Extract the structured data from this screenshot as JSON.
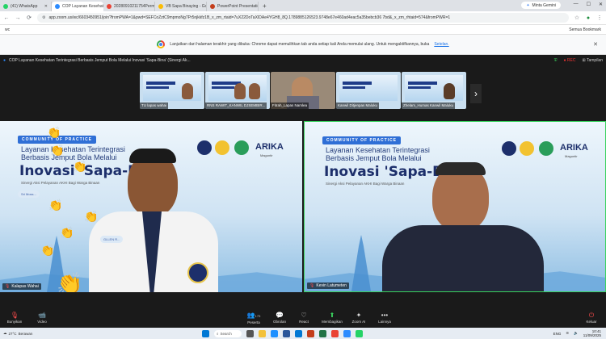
{
  "browser": {
    "tabs": [
      {
        "label": "(41) WhatsApp",
        "color": "#25d366",
        "active": false
      },
      {
        "label": "COP Layanan Kesehatan Te...",
        "color": "#2d8cff",
        "active": true
      },
      {
        "label": "20280910211754Permohonan...",
        "color": "#ea4335",
        "active": false
      },
      {
        "label": "VB Sapa Binaying - Google Dri...",
        "color": "#fbbc05",
        "active": false
      },
      {
        "label": "PowerPoint Presentation",
        "color": "#c43e1c",
        "active": false
      }
    ],
    "new_tab": "+",
    "gemini_label": "Minta Gemini",
    "window_controls": [
      "—",
      "☐",
      "✕"
    ],
    "url": "app.zoom.us/wc/6603450951/join?fromPWA=1&pwd=SEFCoZztC9mpmoNg7Pr5njkkfz1B_x_zm_rtaid=7uX22DoTaXIDAe4YGH8_8Q.1789885126523.9748e67e460ad4eac5a35bebcb36 7bd&_x_zm_rhtaid=574&fromPWR=1",
    "bookmarks_label": "Semua Bookmark",
    "bookmarks_left": "wc",
    "infobar_text": "Lanjutkan dari halaman terakhir yang dibuka: Chrome dapat memulihkan tab anda setiap kali Anda memulai ulang. Untuk mengaktifkannya, buka",
    "infobar_link": "Setelan."
  },
  "meeting": {
    "title": "COP Layanan Kesehatan Terintegrasi Berbasis Jemput Bola Melalui Inovasi 'Sapa-Bina' (Sinergi Ak...",
    "rec_label": "● REC",
    "view_label": "Tampilan"
  },
  "thumbnails": [
    {
      "name": "TU lapas wahai"
    },
    {
      "name": "RNS RAWIT_KANWIL DJSEMBIR..."
    },
    {
      "name": "Fitrah_Lapas Namlea"
    },
    {
      "name": "Kanwil Ditjenpas Maluku"
    },
    {
      "name": "Zhelam_Humas Kanwil Maluku"
    }
  ],
  "slide": {
    "badge": "COMMUNITY OF PRACTICE",
    "line1": "Layanan Kesehatan Terintegrasi",
    "line2": "Berbasis Jemput Bola Melalui",
    "title": "Inovasi 'Sapa-Bina'",
    "subtitle": "Sinergi Aksi Pelayanan AKHI Bagi Warga Binaan",
    "arika": "ARIKA",
    "arika_sub": "Maguntir"
  },
  "tiles": {
    "left_name": "Kalapas Wahai",
    "right_name": "Kevin Latumeten",
    "bubble1": "Sri Moss...",
    "bubble2": "GLLEN R..."
  },
  "toolbar": {
    "items": [
      {
        "label": "Bunyikan",
        "icon": "🎙",
        "red": true
      },
      {
        "label": "Video",
        "icon": "📹",
        "red": false
      },
      {
        "label": "Peserta",
        "icon": "👥",
        "badge": "175",
        "red": false
      },
      {
        "label": "Obrolan",
        "icon": "💬",
        "red": false
      },
      {
        "label": "React",
        "icon": "♡",
        "red": false
      },
      {
        "label": "Membagikan",
        "icon": "⬆",
        "red": false
      },
      {
        "label": "Zoom AI",
        "icon": "✦",
        "red": false
      },
      {
        "label": "Lainnya",
        "icon": "•••",
        "red": false
      }
    ],
    "leave_label": "Keluar"
  },
  "taskbar": {
    "weather_temp": "27°C",
    "weather_text": "Berawan",
    "search_label": "Search",
    "time": "10:41",
    "date": "11/09/2025",
    "lang": "ENG"
  }
}
